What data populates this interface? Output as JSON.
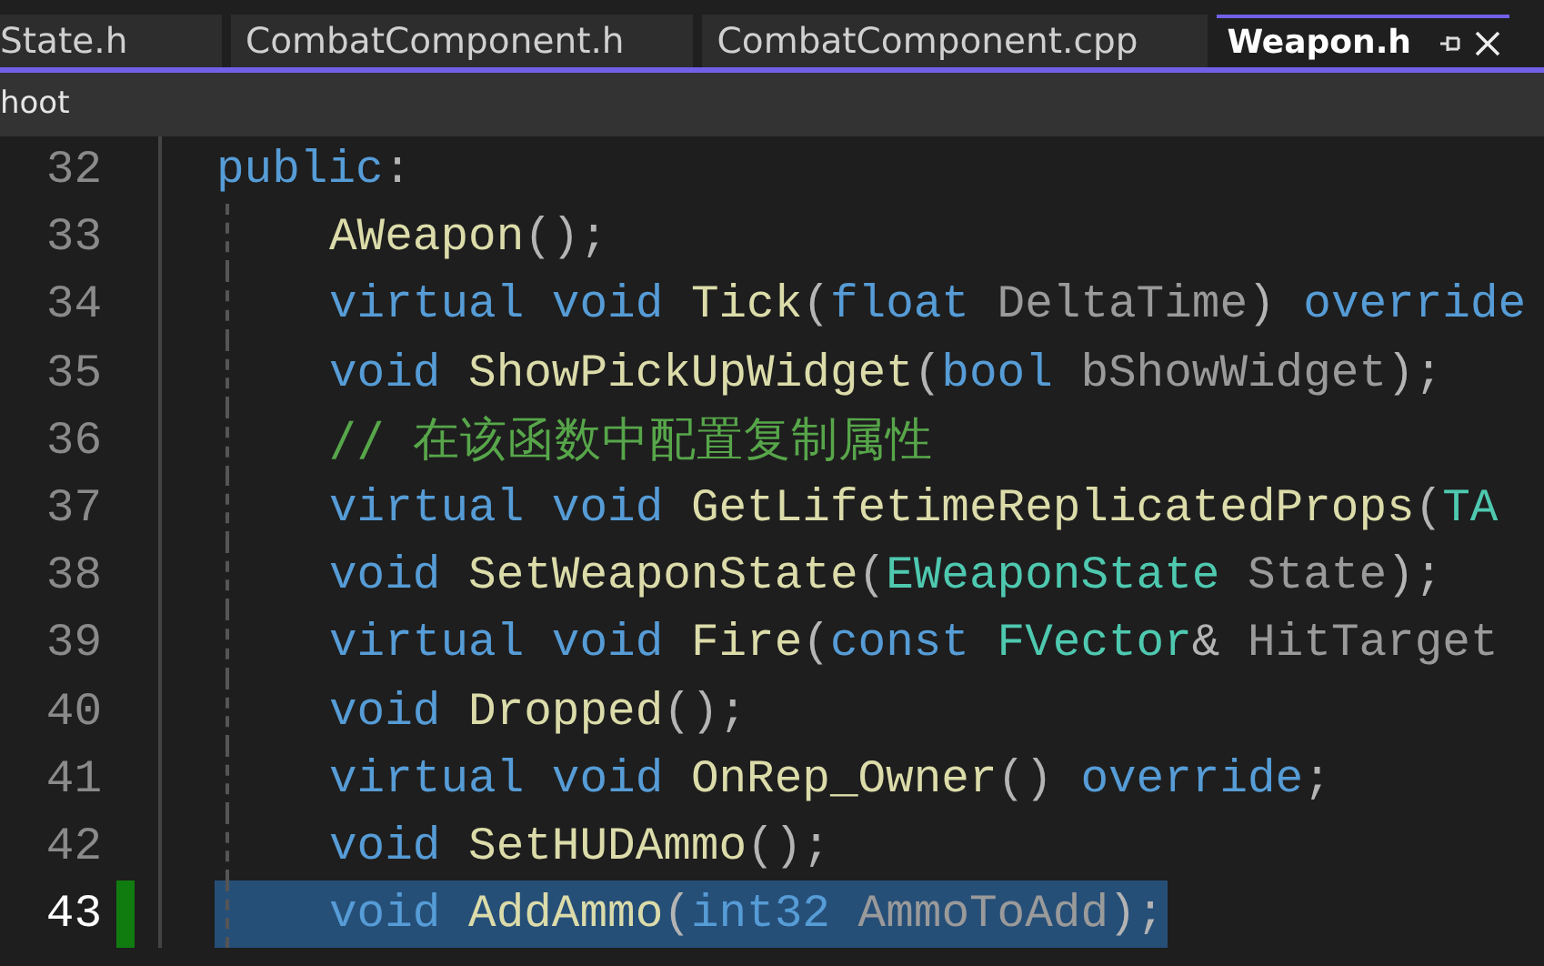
{
  "tabs": [
    {
      "label": "State.h",
      "selected": false
    },
    {
      "label": "CombatComponent.h",
      "selected": false
    },
    {
      "label": "CombatComponent.cpp",
      "selected": false
    },
    {
      "label": "Weapon.h",
      "selected": true
    }
  ],
  "nav_bar": {
    "scope": "hoot"
  },
  "editor": {
    "lines": [
      {
        "number": "32",
        "selected": false,
        "modified": false,
        "tokens": [
          {
            "kind": "keyword",
            "text": "public"
          },
          {
            "kind": "punct",
            "text": ":"
          }
        ],
        "children": [
          {
            "number": "33",
            "selected": false,
            "modified": false,
            "tokens": [
              {
                "kind": "function",
                "text": "AWeapon"
              },
              {
                "kind": "punct",
                "text": "();"
              }
            ]
          },
          {
            "number": "34",
            "selected": false,
            "modified": false,
            "tokens": [
              {
                "kind": "keyword",
                "text": "virtual void "
              },
              {
                "kind": "function",
                "text": "Tick"
              },
              {
                "kind": "punct",
                "text": "("
              },
              {
                "kind": "keyword",
                "text": "float "
              },
              {
                "kind": "param",
                "text": "DeltaTime"
              },
              {
                "kind": "punct",
                "text": ") "
              },
              {
                "kind": "keyword",
                "text": "override"
              }
            ]
          },
          {
            "number": "35",
            "selected": false,
            "modified": false,
            "tokens": [
              {
                "kind": "keyword",
                "text": "void "
              },
              {
                "kind": "function",
                "text": "ShowPickUpWidget"
              },
              {
                "kind": "punct",
                "text": "("
              },
              {
                "kind": "keyword",
                "text": "bool "
              },
              {
                "kind": "param",
                "text": "bShowWidget"
              },
              {
                "kind": "punct",
                "text": ");"
              }
            ]
          },
          {
            "number": "36",
            "selected": false,
            "modified": false,
            "tokens": [
              {
                "kind": "comment",
                "text": "// 在该函数中配置复制属性"
              }
            ]
          },
          {
            "number": "37",
            "selected": false,
            "modified": false,
            "tokens": [
              {
                "kind": "keyword",
                "text": "virtual void "
              },
              {
                "kind": "function",
                "text": "GetLifetimeReplicatedProps"
              },
              {
                "kind": "punct",
                "text": "("
              },
              {
                "kind": "type",
                "text": "TA"
              }
            ]
          },
          {
            "number": "38",
            "selected": false,
            "modified": false,
            "tokens": [
              {
                "kind": "keyword",
                "text": "void "
              },
              {
                "kind": "function",
                "text": "SetWeaponState"
              },
              {
                "kind": "punct",
                "text": "("
              },
              {
                "kind": "type",
                "text": "EWeaponState "
              },
              {
                "kind": "param",
                "text": "State"
              },
              {
                "kind": "punct",
                "text": ");"
              }
            ]
          },
          {
            "number": "39",
            "selected": false,
            "modified": false,
            "tokens": [
              {
                "kind": "keyword",
                "text": "virtual void "
              },
              {
                "kind": "function",
                "text": "Fire"
              },
              {
                "kind": "punct",
                "text": "("
              },
              {
                "kind": "keyword",
                "text": "const "
              },
              {
                "kind": "type",
                "text": "FVector"
              },
              {
                "kind": "punct",
                "text": "& "
              },
              {
                "kind": "param",
                "text": "HitTarget"
              }
            ]
          },
          {
            "number": "40",
            "selected": false,
            "modified": false,
            "tokens": [
              {
                "kind": "keyword",
                "text": "void "
              },
              {
                "kind": "function",
                "text": "Dropped"
              },
              {
                "kind": "punct",
                "text": "();"
              }
            ]
          },
          {
            "number": "41",
            "selected": false,
            "modified": false,
            "tokens": [
              {
                "kind": "keyword",
                "text": "virtual void "
              },
              {
                "kind": "function",
                "text": "OnRep_Owner"
              },
              {
                "kind": "punct",
                "text": "() "
              },
              {
                "kind": "keyword",
                "text": "override"
              },
              {
                "kind": "punct",
                "text": ";"
              }
            ]
          },
          {
            "number": "42",
            "selected": false,
            "modified": false,
            "tokens": [
              {
                "kind": "keyword",
                "text": "void "
              },
              {
                "kind": "function",
                "text": "SetHUDAmmo"
              },
              {
                "kind": "punct",
                "text": "();"
              }
            ]
          },
          {
            "number": "43",
            "selected": true,
            "modified": true,
            "tokens": [
              {
                "kind": "keyword",
                "text": "void "
              },
              {
                "kind": "function",
                "text": "AddAmmo"
              },
              {
                "kind": "punct",
                "text": "("
              },
              {
                "kind": "keyword",
                "text": "int32 "
              },
              {
                "kind": "param",
                "text": "AmmoToAdd"
              },
              {
                "kind": "punct",
                "text": ");"
              }
            ]
          }
        ]
      }
    ]
  }
}
